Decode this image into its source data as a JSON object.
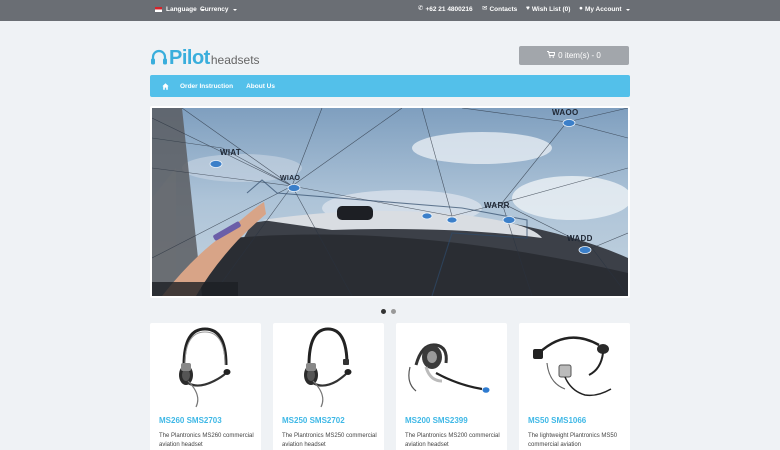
{
  "topbar": {
    "language": "Language",
    "currency": "Currency",
    "phone": "+62 21 4800216",
    "contacts": "Contacts",
    "wishlist": "Wish List (0)",
    "account": "My Account"
  },
  "logo": {
    "pilot": "Pilot",
    "headsets": "headsets"
  },
  "cart": {
    "label": "0 item(s) - 0"
  },
  "nav": {
    "items": [
      "Order Instruction",
      "About Us"
    ]
  },
  "slider": {
    "waypoints": [
      "WIAT",
      "WIAO",
      "WARR",
      "WADD",
      "WAOO"
    ],
    "dots_count": 2,
    "active_dot": 1
  },
  "products": [
    {
      "title": "MS260 SMS2703",
      "desc": "The Plantronics MS260 commercial aviation headset"
    },
    {
      "title": "MS250 SMS2702",
      "desc": "The Plantronics MS250 commercial aviation headset"
    },
    {
      "title": "MS200 SMS2399",
      "desc": "The Plantronics MS200 commercial aviation headset"
    },
    {
      "title": "MS50 SMS1066",
      "desc": "The lightweight Plantronics MS50 commercial aviation"
    }
  ],
  "colors": {
    "accent": "#53c0ea",
    "logo": "#3aaedc",
    "topbar": "#6a6e74",
    "cart": "#a2a6ab",
    "title": "#3fb8e6"
  },
  "icons": {
    "phone": "phone-icon",
    "contacts": "envelope-icon",
    "wishlist": "heart-icon",
    "account": "user-icon",
    "cart": "cart-icon",
    "home": "home-icon"
  }
}
